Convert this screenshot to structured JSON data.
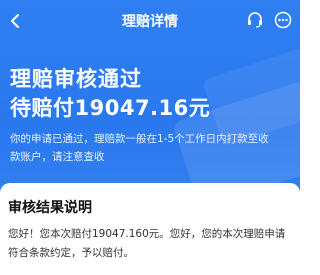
{
  "nav": {
    "title": "理赔详情",
    "back_icon": "chevron-left-icon",
    "right_icons": [
      "customer-service-icon",
      "more-icon"
    ]
  },
  "status": {
    "headline": "理赔审核通过",
    "amount_line": "待赔付19047.16元",
    "description": "你的申请已通过，理赔款一般在1-5个工作日内打款至收款账户，请注意查收"
  },
  "result": {
    "title": "审核结果说明",
    "body": "您好！您本次赔付19047.160元。您好，您的本次理赔申请符合条款约定，予以赔付。"
  },
  "colors": {
    "primary": "#2f7ff2",
    "card_bg": "#ffffff"
  }
}
